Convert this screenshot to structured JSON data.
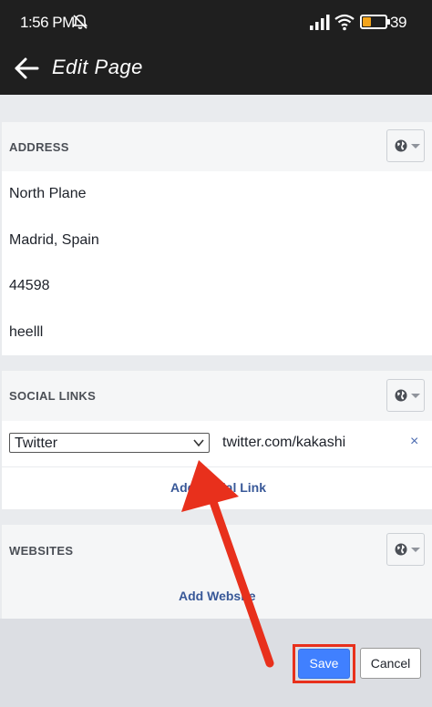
{
  "status_bar": {
    "time": "1:56 PM",
    "battery": "39",
    "mute_icon": "bell-off-icon",
    "signal_icon": "signal-bars-icon",
    "wifi_icon": "wifi-icon",
    "battery_icon": "battery-icon",
    "battery_level_percent": 39,
    "battery_color": "#f3a41b"
  },
  "app_bar": {
    "title": "Edit Page",
    "back_icon": "arrow-left-icon"
  },
  "address": {
    "header": "ADDRESS",
    "privacy_icon": "globe-icon",
    "lines": [
      "North Plane",
      "Madrid, Spain",
      "44598",
      "heelll"
    ]
  },
  "social_links": {
    "header": "SOCIAL LINKS",
    "privacy_icon": "globe-icon",
    "selected_network": "Twitter",
    "url": "twitter.com/kakashi",
    "remove_label": "×",
    "add_label": "Add Social Link"
  },
  "websites": {
    "header": "WEBSITES",
    "privacy_icon": "globe-icon",
    "add_label": "Add Website"
  },
  "footer": {
    "save_label": "Save",
    "cancel_label": "Cancel"
  },
  "colors": {
    "accent": "#4080ff",
    "link": "#385898",
    "annotation_red": "#e8301c",
    "app_bar": "#1f1f1f"
  }
}
